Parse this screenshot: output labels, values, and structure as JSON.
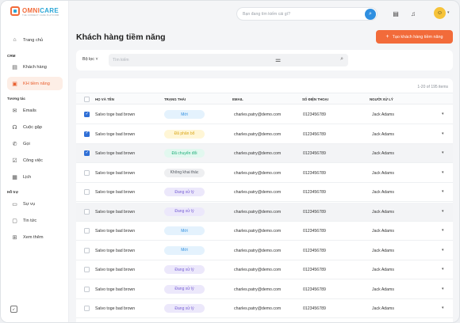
{
  "brand": {
    "name_omni": "OMNI",
    "name_care": "CARE",
    "tagline": "THE CONNECT CARE PLATFORM"
  },
  "sidebar": {
    "items": [
      {
        "label": "Trang chủ",
        "icon": "home-icon"
      },
      {
        "label": "Khách hàng",
        "icon": "customer-icon"
      },
      {
        "label": "KH tiềm năng",
        "icon": "lead-icon",
        "active": true
      },
      {
        "label": "Emails",
        "icon": "mail-icon"
      },
      {
        "label": "Cuộc gặp",
        "icon": "meeting-icon"
      },
      {
        "label": "Gọi",
        "icon": "phone-icon"
      },
      {
        "label": "Công việc",
        "icon": "task-icon"
      },
      {
        "label": "Lịch",
        "icon": "calendar-icon"
      },
      {
        "label": "Sự vụ",
        "icon": "case-icon"
      },
      {
        "label": "Tin tức",
        "icon": "news-icon"
      },
      {
        "label": "Xem thêm",
        "icon": "grid-icon"
      }
    ],
    "groups": {
      "crm": "CRM",
      "tuong_tac": "Tương tác",
      "ho_tro": "Hỗ trợ"
    }
  },
  "topbar": {
    "search_placeholder": "Bạn đang tìm kiếm cái gì?"
  },
  "page": {
    "title": "Khách hàng tiềm năng",
    "create_button": "Tạo khách hàng tiềm năng",
    "filter_label": "Bộ lọc",
    "filter_placeholder": "Tìm kiếm",
    "count_text": "1-20 of 195 items"
  },
  "table": {
    "headers": {
      "name": "HỌ VÀ TÊN",
      "status": "TRẠNG THÁI",
      "email": "EMAIL",
      "phone": "SỐ ĐIỆN THOẠI",
      "handler": "NGƯỜI XỬ LÝ"
    },
    "rows": [
      {
        "name": "Salvo toge bad brown",
        "status": "Mới",
        "email": "charles.patry@demo.com",
        "phone": "0123456789",
        "handler": "Jack Adams",
        "checked": true
      },
      {
        "name": "Salvo toge bad brown",
        "status": "Đã phân bổ",
        "email": "charles.patry@demo.com",
        "phone": "0123456789",
        "handler": "Jack Adams",
        "checked": true
      },
      {
        "name": "Salvo toge bad brown",
        "status": "Đã chuyển đổi",
        "email": "charles.patry@demo.com",
        "phone": "0123456789",
        "handler": "Jack Adams",
        "checked": true
      },
      {
        "name": "Salvo toge bad brown",
        "status": "Không khai thác",
        "email": "charles.patry@demo.com",
        "phone": "0123456789",
        "handler": "Jack Adams",
        "checked": false
      },
      {
        "name": "Salvo toge bad brown",
        "status": "Đang xử lý",
        "email": "charles.patry@demo.com",
        "phone": "0123456789",
        "handler": "Jack Adams",
        "checked": false
      },
      {
        "name": "Salvo toge bad brown",
        "status": "Đang xử lý",
        "email": "charles.patry@demo.com",
        "phone": "0123456789",
        "handler": "Jack Adams",
        "checked": false
      },
      {
        "name": "Salvo toge bad brown",
        "status": "Mới",
        "email": "charles.patry@demo.com",
        "phone": "0123456789",
        "handler": "Jack Adams",
        "checked": false
      },
      {
        "name": "Salvo toge bad brown",
        "status": "Mới",
        "email": "charles.patry@demo.com",
        "phone": "0123456789",
        "handler": "Jack Adams",
        "checked": false
      },
      {
        "name": "Salvo toge bad brown",
        "status": "Đang xử lý",
        "email": "charles.patry@demo.com",
        "phone": "0123456789",
        "handler": "Jack Adams",
        "checked": false
      },
      {
        "name": "Salvo toge bad brown",
        "status": "Đang xử lý",
        "email": "charles.patry@demo.com",
        "phone": "0123456789",
        "handler": "Jack Adams",
        "checked": false
      },
      {
        "name": "Salvo toge bad brown",
        "status": "Đang xử lý",
        "email": "charles.patry@demo.com",
        "phone": "0123456789",
        "handler": "Jack Adams",
        "checked": false
      }
    ]
  },
  "colors": {
    "accent": "#f26b3a",
    "checkbox": "#2f6fd6",
    "status_new_bg": "#e4f2fd",
    "status_new_fg": "#2f8fe0",
    "status_assigned_bg": "#fff6d6",
    "status_assigned_fg": "#d9a514",
    "status_converted_bg": "#e2f8ef",
    "status_converted_fg": "#1fae7a",
    "status_unused_bg": "#eeeff1",
    "status_unused_fg": "#555a62",
    "status_processing_bg": "#ece8fb",
    "status_processing_fg": "#7a62d6"
  }
}
